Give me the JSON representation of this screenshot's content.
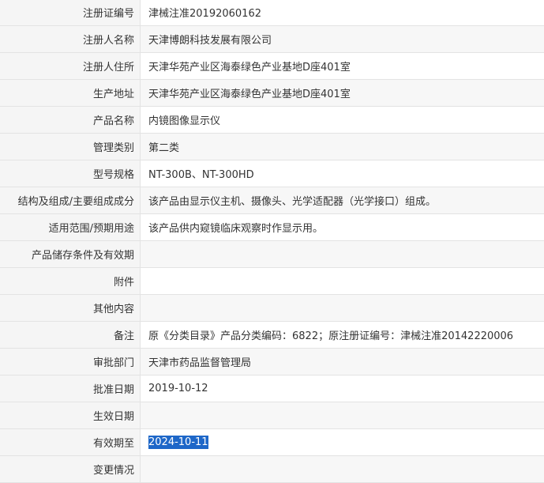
{
  "rows": [
    {
      "label": "注册证编号",
      "value": "津械注准20192060162"
    },
    {
      "label": "注册人名称",
      "value": "天津博朗科技发展有限公司"
    },
    {
      "label": "注册人住所",
      "value": "天津华苑产业区海泰绿色产业基地D座401室"
    },
    {
      "label": "生产地址",
      "value": "天津华苑产业区海泰绿色产业基地D座401室"
    },
    {
      "label": "产品名称",
      "value": "内镜图像显示仪"
    },
    {
      "label": "管理类别",
      "value": "第二类"
    },
    {
      "label": "型号规格",
      "value": "NT-300B、NT-300HD"
    },
    {
      "label": "结构及组成/主要组成成分",
      "value": "该产品由显示仪主机、摄像头、光学适配器（光学接口）组成。"
    },
    {
      "label": "适用范围/预期用途",
      "value": "该产品供内窥镜临床观察时作显示用。"
    },
    {
      "label": "产品储存条件及有效期",
      "value": ""
    },
    {
      "label": "附件",
      "value": ""
    },
    {
      "label": "其他内容",
      "value": ""
    },
    {
      "label": "备注",
      "value": "原《分类目录》产品分类编码：6822；原注册证编号：津械注准20142220006"
    },
    {
      "label": "审批部门",
      "value": "天津市药品监督管理局"
    },
    {
      "label": "批准日期",
      "value": "2019-10-12"
    },
    {
      "label": "生效日期",
      "value": ""
    },
    {
      "label": "有效期至",
      "value": "2024-10-11",
      "selected": true
    },
    {
      "label": "变更情况",
      "value": ""
    }
  ],
  "colors": {
    "label_bg": "#f5f5f5",
    "alt_row_bg": "#f7f7f7",
    "border": "#e3e3e3",
    "selection": "#1e67c8",
    "text": "#333333"
  }
}
